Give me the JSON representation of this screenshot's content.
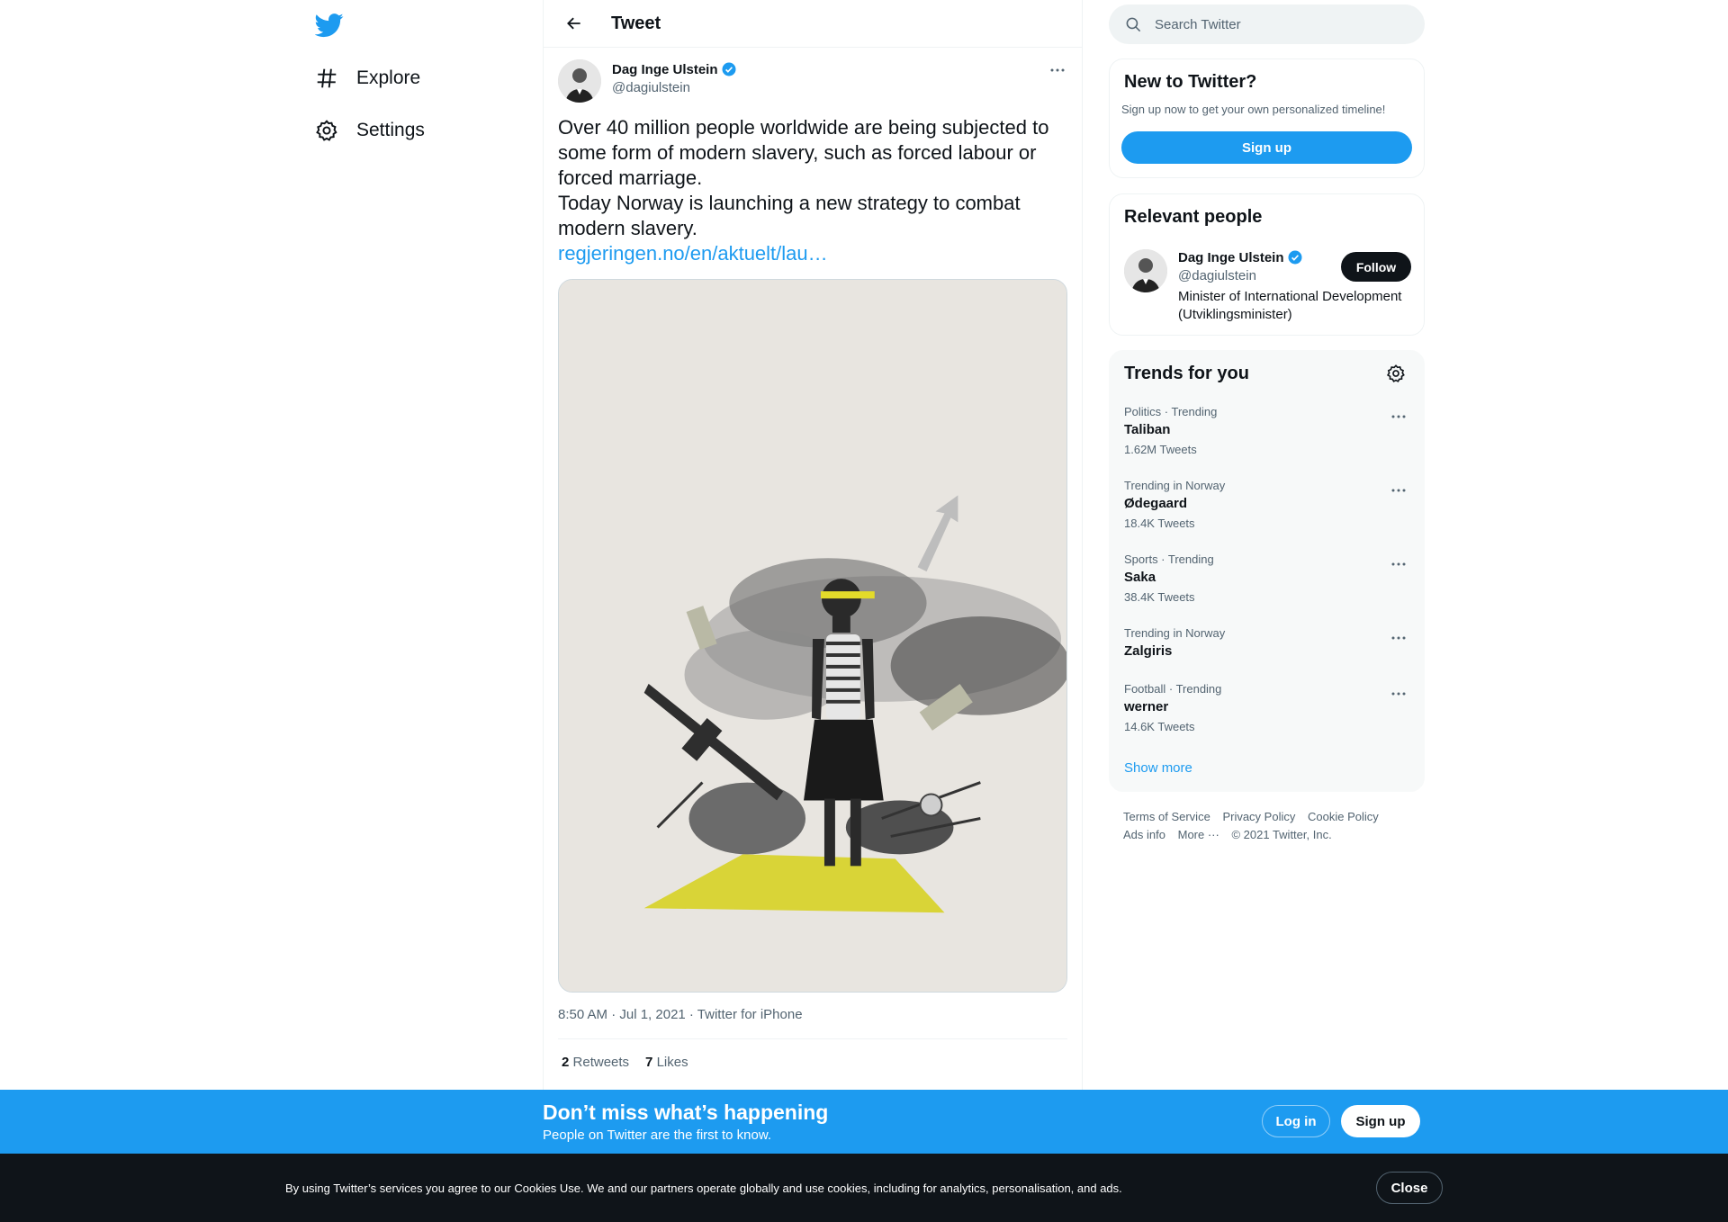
{
  "nav": {
    "logo_icon": "twitter-bird-icon",
    "items": [
      {
        "label": "Explore",
        "icon": "hashtag-icon"
      },
      {
        "label": "Settings",
        "icon": "gear-icon"
      }
    ]
  },
  "header": {
    "title": "Tweet"
  },
  "tweet": {
    "author_name": "Dag Inge Ulstein",
    "author_handle": "@dagiulstein",
    "text_lines": [
      "Over 40 million people worldwide are being subjected to some form of modern slavery, such as forced labour or forced marriage.",
      "Today Norway is launching a new strategy to combat modern slavery."
    ],
    "link": "regjeringen.no/en/aktuelt/lau…",
    "meta": "8:50 AM · Jul 1, 2021 · Twitter for iPhone",
    "retweets_count": "2",
    "retweets_label": "Retweets",
    "likes_count": "7",
    "likes_label": "Likes"
  },
  "search": {
    "placeholder": "Search Twitter"
  },
  "new_to_twitter": {
    "title": "New to Twitter?",
    "subtitle": "Sign up now to get your own personalized timeline!",
    "button": "Sign up"
  },
  "relevant_people": {
    "title": "Relevant people",
    "name": "Dag Inge Ulstein",
    "handle": "@dagiulstein",
    "bio": "Minister of International Development (Utviklingsminister)",
    "follow": "Follow"
  },
  "trends": {
    "title": "Trends for you",
    "items": [
      {
        "category": "Politics · Trending",
        "name": "Taliban",
        "count": "1.62M Tweets"
      },
      {
        "category": "Trending in Norway",
        "name": "Ødegaard",
        "count": "18.4K Tweets"
      },
      {
        "category": "Sports · Trending",
        "name": "Saka",
        "count": "38.4K Tweets"
      },
      {
        "category": "Trending in Norway",
        "name": "Zalgiris",
        "count": ""
      },
      {
        "category": "Football · Trending",
        "name": "werner",
        "count": "14.6K Tweets"
      }
    ],
    "show_more": "Show more"
  },
  "footer": {
    "links": [
      "Terms of Service",
      "Privacy Policy",
      "Cookie Policy",
      "Ads info",
      "More ···",
      "© 2021 Twitter, Inc."
    ]
  },
  "bottom_bar": {
    "title": "Don’t miss what’s happening",
    "subtitle": "People on Twitter are the first to know.",
    "login": "Log in",
    "signup": "Sign up"
  },
  "cookie_bar": {
    "text": "By using Twitter’s services you agree to our Cookies Use. We and our partners operate globally and use cookies, including for analytics, personalisation, and ads.",
    "close": "Close"
  },
  "colors": {
    "accent": "#1d9bf0",
    "text": "#0f1419",
    "secondary": "#536471",
    "cookie_bg": "#0f1419"
  }
}
